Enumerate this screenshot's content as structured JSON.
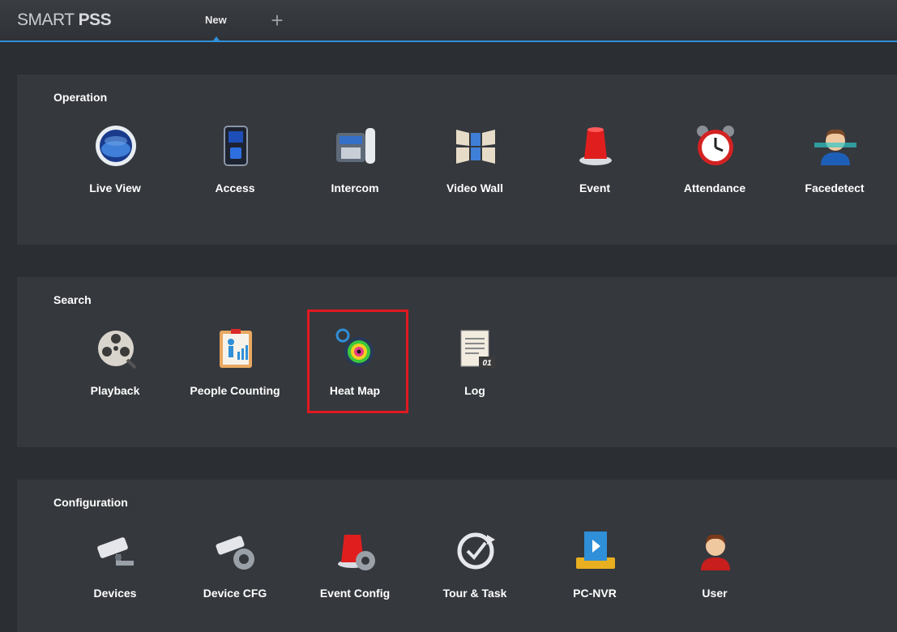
{
  "header": {
    "logo_light": "SMART",
    "logo_bold": "PSS",
    "tab_label": "New",
    "add_tab": "+"
  },
  "sections": [
    {
      "title": "Operation",
      "items": [
        {
          "label": "Live View",
          "icon": "live-view-icon"
        },
        {
          "label": "Access",
          "icon": "access-icon"
        },
        {
          "label": "Intercom",
          "icon": "intercom-icon"
        },
        {
          "label": "Video Wall",
          "icon": "video-wall-icon"
        },
        {
          "label": "Event",
          "icon": "event-icon"
        },
        {
          "label": "Attendance",
          "icon": "attendance-icon"
        },
        {
          "label": "Facedetect",
          "icon": "facedetect-icon"
        }
      ]
    },
    {
      "title": "Search",
      "items": [
        {
          "label": "Playback",
          "icon": "playback-icon"
        },
        {
          "label": "People Counting",
          "icon": "people-counting-icon"
        },
        {
          "label": "Heat Map",
          "icon": "heat-map-icon"
        },
        {
          "label": "Log",
          "icon": "log-icon",
          "icon_text": "01"
        }
      ]
    },
    {
      "title": "Configuration",
      "items": [
        {
          "label": "Devices",
          "icon": "devices-icon"
        },
        {
          "label": "Device CFG",
          "icon": "device-cfg-icon"
        },
        {
          "label": "Event Config",
          "icon": "event-config-icon"
        },
        {
          "label": "Tour & Task",
          "icon": "tour-task-icon"
        },
        {
          "label": "PC-NVR",
          "icon": "pc-nvr-icon"
        },
        {
          "label": "User",
          "icon": "user-icon"
        }
      ]
    }
  ],
  "colors": {
    "background": "#2b2e33",
    "panel": "#35383d",
    "accent": "#2f8fd8",
    "highlight": "#e0191f"
  }
}
